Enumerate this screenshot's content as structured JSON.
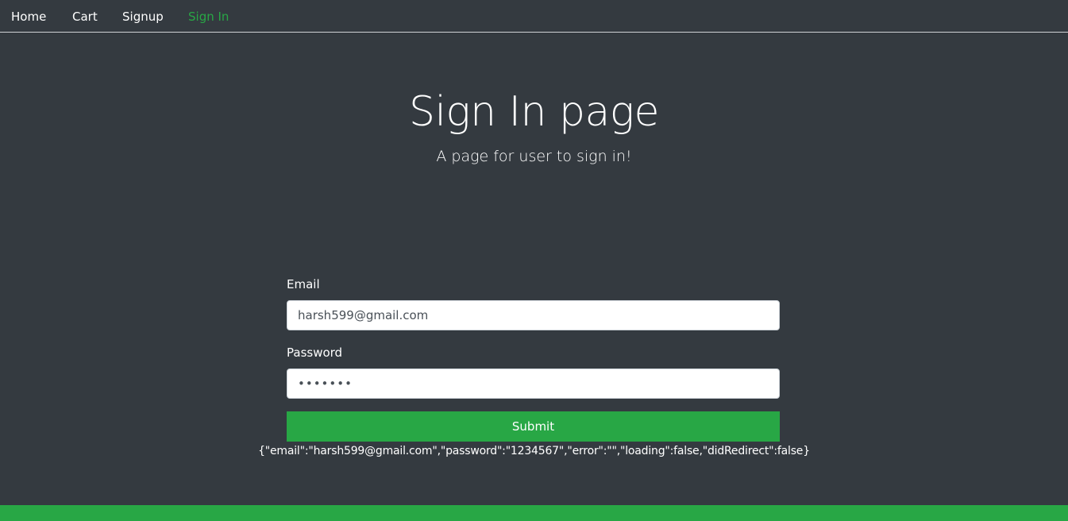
{
  "nav": {
    "items": [
      {
        "label": "Home",
        "active": false
      },
      {
        "label": "Cart",
        "active": false
      },
      {
        "label": "Signup",
        "active": false
      },
      {
        "label": "Sign In",
        "active": true
      }
    ]
  },
  "hero": {
    "title": "Sign In page",
    "subtitle": "A page for user to sign in!"
  },
  "form": {
    "email_label": "Email",
    "email_value": "harsh599@gmail.com",
    "password_label": "Password",
    "password_value": "1234567",
    "submit_label": "Submit"
  },
  "debug_state": "{\"email\":\"harsh599@gmail.com\",\"password\":\"1234567\",\"error\":\"\",\"loading\":false,\"didRedirect\":false}",
  "colors": {
    "background": "#343a40",
    "accent": "#28a745",
    "text": "#ffffff"
  }
}
